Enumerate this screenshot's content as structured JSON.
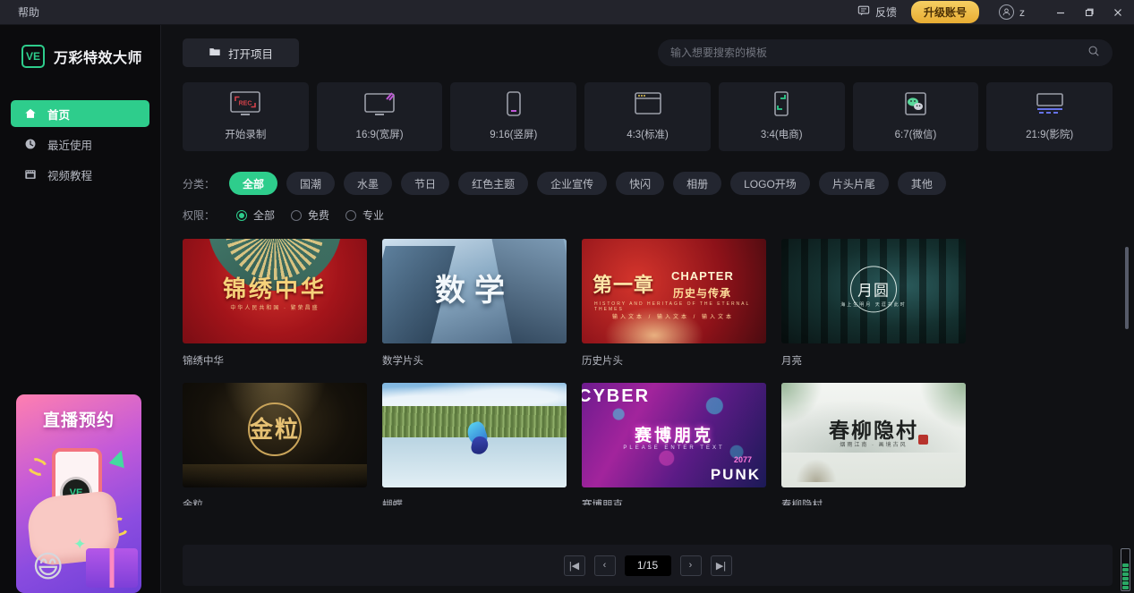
{
  "titlebar": {
    "menu": "帮助",
    "feedback": "反馈",
    "feedback_icon": "speech-bubble-icon",
    "upgrade": "升级账号",
    "user": "z",
    "user_icon": "person-icon",
    "minimize": "–",
    "maximize": "❐",
    "close": "✕"
  },
  "sidebar": {
    "logo_text": "VE",
    "app_name": "万彩特效大师",
    "items": [
      {
        "label": "首页",
        "icon": "home-icon",
        "active": true
      },
      {
        "label": "最近使用",
        "icon": "clock-icon",
        "active": false
      },
      {
        "label": "视频教程",
        "icon": "video-tutorial-icon",
        "active": false
      }
    ],
    "promo": {
      "title": "直播预约",
      "logo_text": "VE",
      "emoji": "😄",
      "star": "✦"
    }
  },
  "toolbar": {
    "open_project": "打开项目",
    "open_project_icon": "folder-icon",
    "search_placeholder": "输入想要搜索的模板",
    "search_value": "",
    "search_icon": "search-icon"
  },
  "presets": [
    {
      "label": "开始录制",
      "icon": "record-monitor-icon"
    },
    {
      "label": "16:9(宽屏)",
      "icon": "widescreen-monitor-icon"
    },
    {
      "label": "9:16(竖屏)",
      "icon": "phone-portrait-icon"
    },
    {
      "label": "4:3(标准)",
      "icon": "window-standard-icon"
    },
    {
      "label": "3:4(电商)",
      "icon": "ecommerce-frame-icon"
    },
    {
      "label": "6:7(微信)",
      "icon": "wechat-icon"
    },
    {
      "label": "21:9(影院)",
      "icon": "cinema-screen-icon"
    }
  ],
  "filters": {
    "category_label": "分类：",
    "categories": [
      {
        "label": "全部",
        "active": true
      },
      {
        "label": "国潮",
        "active": false
      },
      {
        "label": "水墨",
        "active": false
      },
      {
        "label": "节日",
        "active": false
      },
      {
        "label": "红色主题",
        "active": false
      },
      {
        "label": "企业宣传",
        "active": false
      },
      {
        "label": "快闪",
        "active": false
      },
      {
        "label": "相册",
        "active": false
      },
      {
        "label": "LOGO开场",
        "active": false
      },
      {
        "label": "片头片尾",
        "active": false
      },
      {
        "label": "其他",
        "active": false
      }
    ],
    "permission_label": "权限：",
    "permissions": [
      {
        "label": "全部",
        "selected": true
      },
      {
        "label": "免费",
        "selected": false
      },
      {
        "label": "专业",
        "selected": false
      }
    ]
  },
  "templates": [
    {
      "name": "锦绣中华",
      "art": "t-jinxiu",
      "title": "锦绣中华",
      "sub": "中华人民共和国 · 繁荣昌盛"
    },
    {
      "name": "数学片头",
      "art": "t-shuxue",
      "title": "数学",
      "sub": ""
    },
    {
      "name": "历史片头",
      "art": "t-lishi",
      "title": "第一章",
      "en": "CHAPTER",
      "sub": "历史与传承",
      "tiny": "HISTORY AND HERITAGE OF THE ETERNAL THEMES",
      "tiny2": "输入文本  /  输入文本  /  输入文本"
    },
    {
      "name": "月亮",
      "art": "t-yueliang",
      "title": "月圆",
      "sub": "海上生明月 天涯共此时"
    },
    {
      "name": "金粒",
      "art": "t-jinli",
      "title": "金粒",
      "sub": ""
    },
    {
      "name": "蝴蝶",
      "art": "t-hudie",
      "title": "",
      "sub": ""
    },
    {
      "name": "赛博朋克",
      "art": "t-cyber",
      "title": "赛博朋克",
      "cyber": "CYBER",
      "please": "PLEASE ENTER TEXT",
      "year": "2077",
      "punk": "PUNK"
    },
    {
      "name": "春柳隐村",
      "art": "t-shuimo",
      "title": "春柳隐村",
      "sub": "烟雨江南 · 画境古风"
    }
  ],
  "pagination": {
    "first": "|◀",
    "prev": "‹",
    "indicator": "1/15",
    "next": "›",
    "last": "▶|"
  }
}
